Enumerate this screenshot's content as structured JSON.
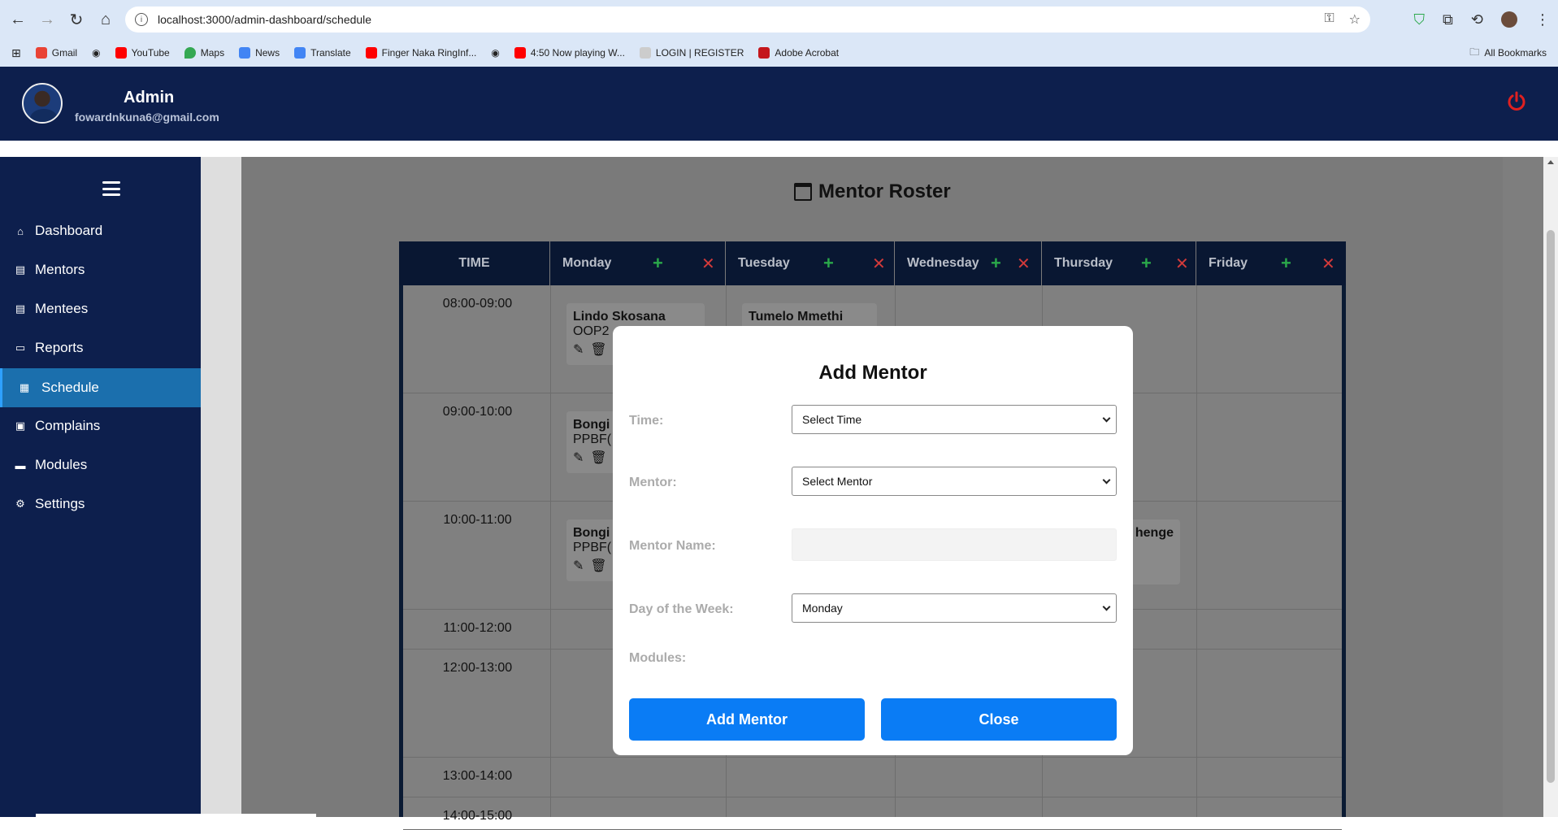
{
  "browser": {
    "url": "localhost:3000/admin-dashboard/schedule",
    "bookmarks": [
      "Gmail",
      "YouTube",
      "Maps",
      "News",
      "Translate",
      "Finger Naka RingInf...",
      "4:50 Now playing W...",
      "LOGIN | REGISTER",
      "Adobe Acrobat"
    ],
    "all_bookmarks": "All Bookmarks"
  },
  "header": {
    "name": "Admin",
    "email": "fowardnkuna6@gmail.com"
  },
  "sidebar": {
    "items": [
      {
        "label": "Dashboard",
        "icon": "home-icon"
      },
      {
        "label": "Mentors",
        "icon": "id-card-icon"
      },
      {
        "label": "Mentees",
        "icon": "id-card-icon"
      },
      {
        "label": "Reports",
        "icon": "comment-icon"
      },
      {
        "label": "Schedule",
        "icon": "calendar-icon",
        "active": true
      },
      {
        "label": "Complains",
        "icon": "clipboard-icon"
      },
      {
        "label": "Modules",
        "icon": "book-icon"
      },
      {
        "label": "Settings",
        "icon": "gear-icon"
      }
    ]
  },
  "roster": {
    "title": "Mentor Roster",
    "columns": [
      "TIME",
      "Monday",
      "Tuesday",
      "Wednesday",
      "Thursday",
      "Friday"
    ],
    "times": [
      "08:00-09:00",
      "09:00-10:00",
      "10:00-11:00",
      "11:00-12:00",
      "12:00-13:00",
      "13:00-14:00",
      "14:00-15:00"
    ],
    "cards": [
      {
        "name": "Lindo Skosana",
        "module": "OOP2"
      },
      {
        "name": "Tumelo Mmethi",
        "module": ""
      },
      {
        "name": "Bongi",
        "module": "PPBF("
      },
      {
        "name": "Bongi",
        "module": "PPBF("
      },
      {
        "name": "henge",
        "module": ""
      }
    ]
  },
  "modal": {
    "title": "Add Mentor",
    "time_label": "Time:",
    "time_value": "Select Time",
    "mentor_label": "Mentor:",
    "mentor_value": "Select Mentor",
    "mentor_name_label": "Mentor Name:",
    "mentor_name_value": "",
    "day_label": "Day of the Week:",
    "day_value": "Monday",
    "modules_label": "Modules:",
    "add_button": "Add Mentor",
    "close_button": "Close"
  },
  "colors": {
    "navy": "#0d1f4d",
    "active": "#1b6fad",
    "primary_button": "#0a7cf5",
    "power": "#e02020"
  }
}
